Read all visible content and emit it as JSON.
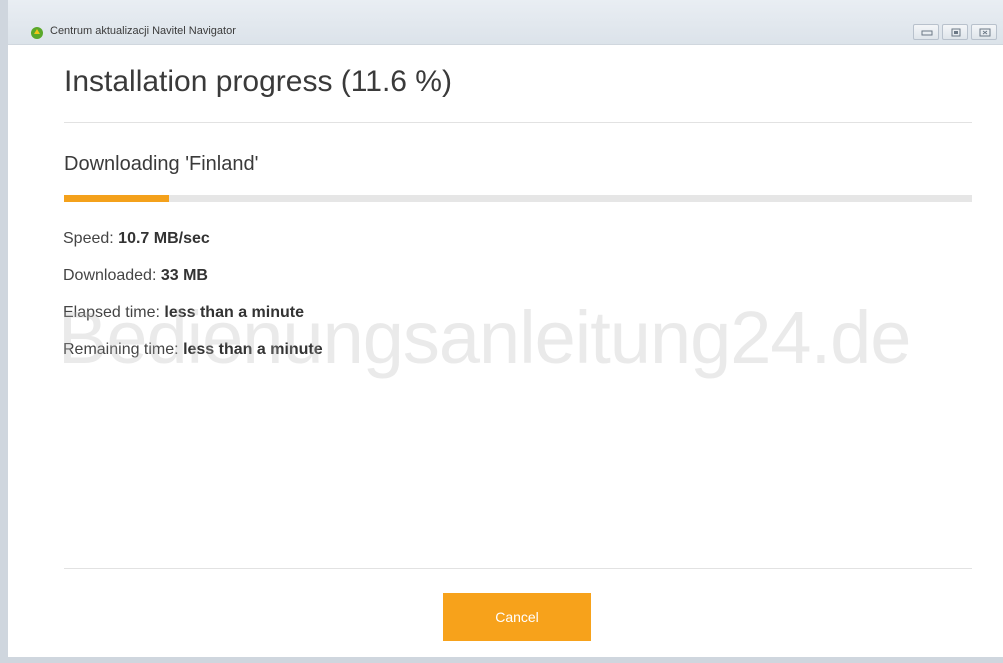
{
  "window": {
    "title": "Centrum aktualizacji Navitel Navigator",
    "icon": "navitel-app-icon",
    "controls": [
      "minimize-icon",
      "maximize-icon",
      "close-icon"
    ]
  },
  "header": {
    "title": "Installation progress (11.6 %)"
  },
  "task": {
    "label": "Downloading 'Finland'",
    "progress_percent": 11.6
  },
  "stats": [
    {
      "label": "Speed:",
      "value": "10.7 MB/sec"
    },
    {
      "label": "Downloaded:",
      "value": "33 MB"
    },
    {
      "label": "Elapsed time:",
      "value": "less than a minute"
    },
    {
      "label": "Remaining time:",
      "value": "less than a minute"
    }
  ],
  "watermark": "Bedienungsanleitung24.de",
  "actions": {
    "cancel_label": "Cancel"
  },
  "colors": {
    "accent": "#f4a11b",
    "track": "#e6e6e6"
  }
}
